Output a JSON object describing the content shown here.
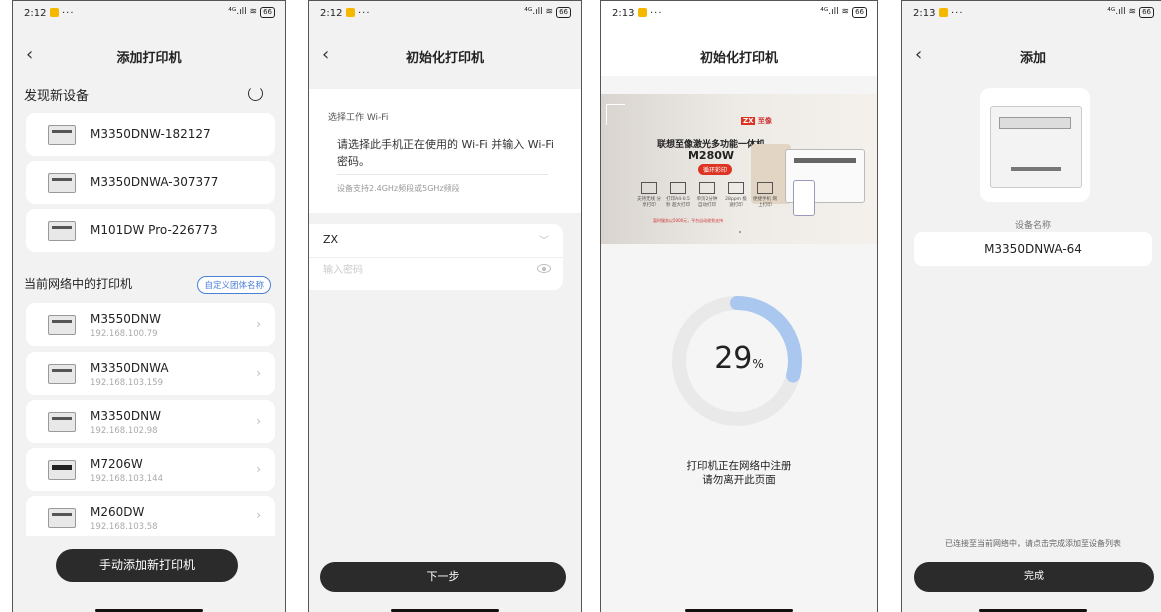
{
  "status_bars": [
    {
      "time": "2:12",
      "signal": "⁴ᴳ.ıll",
      "battery": "66"
    },
    {
      "time": "2:12",
      "signal": "⁴ᴳ.ıll",
      "battery": "66"
    },
    {
      "time": "2:13",
      "signal": "⁴ᴳ.ıll",
      "battery": "66"
    },
    {
      "time": "2:13",
      "signal": "⁴ᴳ.ıll",
      "battery": "66"
    }
  ],
  "screen1": {
    "title": "添加打印机",
    "discover_header": "发现新设备",
    "new_devices": [
      {
        "name": "M3350DNW-182127"
      },
      {
        "name": "M3350DNWA-307377"
      },
      {
        "name": "M101DW Pro-226773"
      }
    ],
    "network_header": "当前网络中的打印机",
    "custom_name_button": "自定义团体名称",
    "network_printers": [
      {
        "name": "M3550DNW",
        "ip": "192.168.100.79"
      },
      {
        "name": "M3350DNWA",
        "ip": "192.168.103.159"
      },
      {
        "name": "M3350DNW",
        "ip": "192.168.102.98"
      },
      {
        "name": "M7206W",
        "ip": "192.168.103.144"
      },
      {
        "name": "M260DW",
        "ip": "192.168.103.58"
      }
    ],
    "manual_add_button": "手动添加新打印机"
  },
  "screen2": {
    "title": "初始化打印机",
    "wifi_label": "选择工作 Wi-Fi",
    "wifi_desc": "请选择此手机正在使用的 Wi-Fi 并输入 Wi-Fi 密码。",
    "wifi_note": "设备支持2.4GHz频段或5GHz频段",
    "ssid_value": "ZX",
    "password_placeholder": "输入密码",
    "next_button": "下一步"
  },
  "screen3": {
    "title": "初始化打印机",
    "banner": {
      "brand": "至像",
      "brand_logo": "ZX",
      "headline": "联想至像激光多功能一体机",
      "model": "M280W",
      "tag": "循环彩印",
      "features": [
        "支持无线 分享打印",
        "打印A4-0.5秒 超大打印",
        "单页2分钟 自动打印",
        "28ppm 极速打印",
        "便捷手机 网上打印"
      ],
      "bottom_note": "暂时服务以5000元，平台自动收到支持"
    },
    "progress": {
      "value": 29,
      "unit": "%"
    },
    "message_line1": "打印机正在网络中注册",
    "message_line2": "请勿离开此页面"
  },
  "screen4": {
    "title": "添加",
    "device_label": "设备名称",
    "device_name": "M3350DNWA-64",
    "note": "已连接至当前网络中，请点击完成添加至设备列表",
    "done_button": "完成"
  }
}
